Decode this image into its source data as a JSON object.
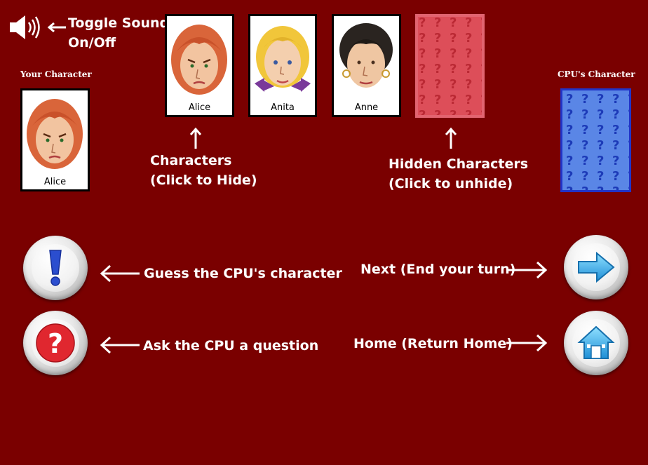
{
  "sound": {
    "icon": "speaker-icon",
    "label_line1": "Toggle Sound",
    "label_line2": "On/Off"
  },
  "your_character": {
    "heading": "Your Character",
    "card_name": "Alice"
  },
  "cpu_character": {
    "heading": "CPU's Character"
  },
  "characters": [
    {
      "name": "Alice",
      "hair": "red"
    },
    {
      "name": "Anita",
      "hair": "blonde"
    },
    {
      "name": "Anne",
      "hair": "black"
    }
  ],
  "hints": {
    "characters_line1": "Characters",
    "characters_line2": "(Click to Hide)",
    "hidden_line1": "Hidden Characters",
    "hidden_line2": "(Click to unhide)",
    "guess": "Guess the CPU's character",
    "ask": "Ask the CPU a question",
    "next": "Next (End your turn)",
    "home": "Home (Return Home)"
  },
  "buttons": {
    "guess_icon": "exclamation-icon",
    "ask_icon": "question-mark-icon",
    "next_icon": "arrow-right-icon",
    "home_icon": "home-icon"
  },
  "colors": {
    "background": "#7a0000",
    "hidden_card": "#d9414c",
    "cpu_card": "#4f7be0",
    "card_border": "#000000"
  }
}
